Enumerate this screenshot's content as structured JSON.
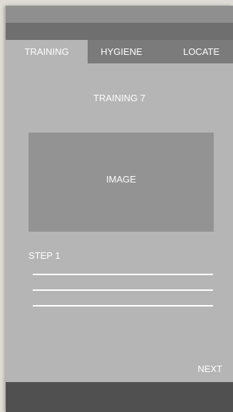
{
  "tabs": [
    {
      "label": "TRAINING",
      "active": true
    },
    {
      "label": "HYGIENE",
      "active": false
    },
    {
      "label": "LOCATE",
      "active": false
    }
  ],
  "page": {
    "title": "TRAINING 7",
    "image_label": "IMAGE",
    "step_label": "STEP 1",
    "next_label": "NEXT"
  },
  "colors": {
    "background": "#b5b5b5",
    "status_bar": "#8f8f8f",
    "app_bar": "#6f6f6f",
    "tab_bar": "#7b7b7b",
    "active_tab": "#b5b5b5",
    "image_placeholder": "#939393",
    "bottom_bar": "#505050",
    "text": "#ffffff"
  }
}
